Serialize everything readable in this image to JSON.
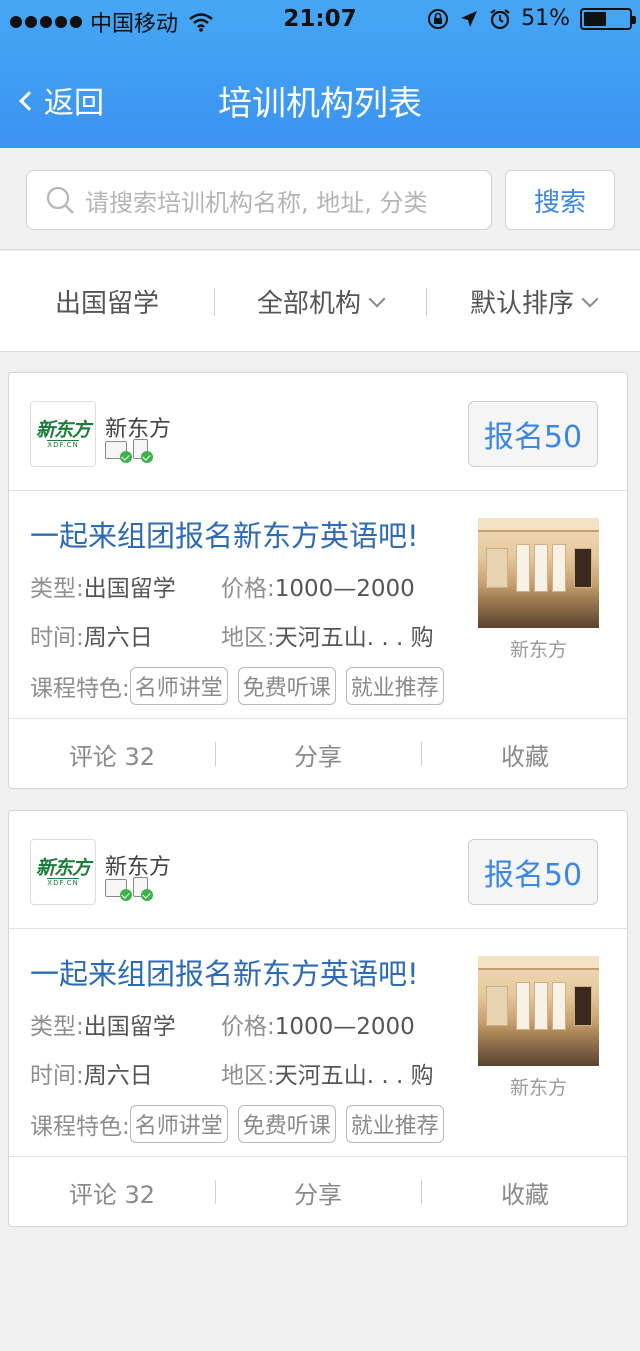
{
  "status_bar": {
    "carrier": "中国移动",
    "time": "21:07",
    "battery": "51%",
    "battery_level": 0.51
  },
  "nav": {
    "back_label": "返回",
    "title": "培训机构列表"
  },
  "search": {
    "placeholder": "请搜索培训机构名称, 地址, 分类",
    "button_label": "搜索"
  },
  "filters": {
    "category": "出国留学",
    "org": "全部机构",
    "sort": "默认排序"
  },
  "cards": [
    {
      "logo_text": "新东方",
      "logo_sub": "XDF.CN",
      "org_name": "新东方",
      "enroll_label": "报名50",
      "course_title": "一起来组团报名新东方英语吧!",
      "type_label": "类型:",
      "type_value": "出国留学",
      "price_label": "价格:",
      "price_value": "1000—2000",
      "time_label": "时间:",
      "time_value": "周六日",
      "area_label": "地区:",
      "area_value": "天河五山. . . 购",
      "features_label": "课程特色:",
      "features": [
        "名师讲堂",
        "免费听课",
        "就业推荐"
      ],
      "thumb_caption": "新东方",
      "comments": "评论 32",
      "share": "分享",
      "favorite": "收藏"
    },
    {
      "logo_text": "新东方",
      "logo_sub": "XDF.CN",
      "org_name": "新东方",
      "enroll_label": "报名50",
      "course_title": "一起来组团报名新东方英语吧!",
      "type_label": "类型:",
      "type_value": "出国留学",
      "price_label": "价格:",
      "price_value": "1000—2000",
      "time_label": "时间:",
      "time_value": "周六日",
      "area_label": "地区:",
      "area_value": "天河五山. . . 购",
      "features_label": "课程特色:",
      "features": [
        "名师讲堂",
        "免费听课",
        "就业推荐"
      ],
      "thumb_caption": "新东方",
      "comments": "评论 32",
      "share": "分享",
      "favorite": "收藏"
    }
  ],
  "colors": {
    "header": "#3b92f0",
    "accent": "#3a87e6",
    "title_blue": "#2d6bb7",
    "logo_green": "#1a7d3a",
    "check_green": "#3cb34a"
  }
}
